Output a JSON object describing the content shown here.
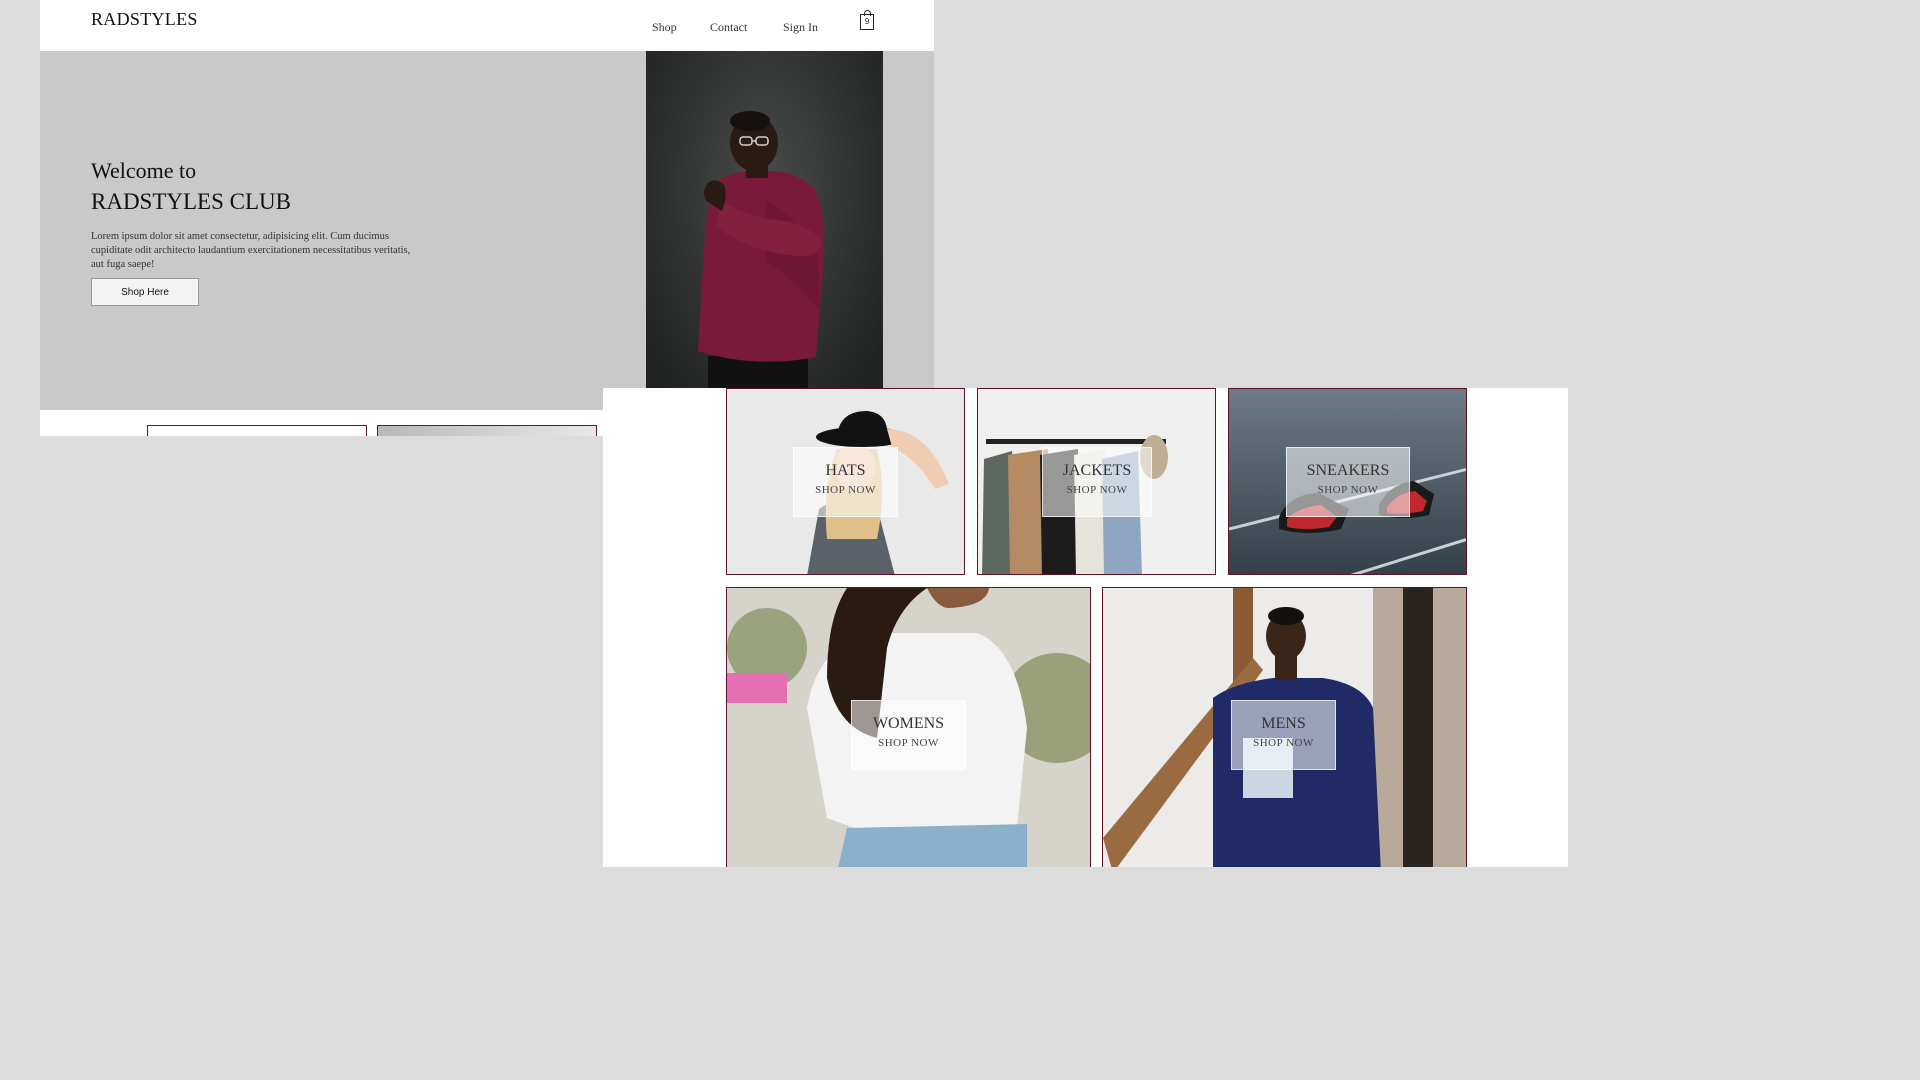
{
  "site": {
    "brand": "RADSTYLES",
    "nav": [
      "Shop",
      "Contact",
      "Sign In"
    ],
    "cart_count": "9",
    "cart_icon": "shopping-bag-icon"
  },
  "hero": {
    "welcome": "Welcome to",
    "title": "RADSTYLES CLUB",
    "description": "Lorem ipsum dolor sit amet consectetur, adipisicing elit. Cum ducimus cupiditate odit architecto laudantium exercitationem necessitatibus veritatis, aut fuga saepe!",
    "button": "Shop Here"
  },
  "categories": [
    {
      "name": "HATS",
      "cta": "SHOP NOW"
    },
    {
      "name": "JACKETS",
      "cta": "SHOP NOW"
    },
    {
      "name": "SNEAKERS",
      "cta": "SHOP NOW"
    },
    {
      "name": "WOMENS",
      "cta": "SHOP NOW"
    },
    {
      "name": "MENS",
      "cta": "SHOP NOW"
    }
  ],
  "colors": {
    "page_background": "#dcdcdc",
    "hero_background": "#c9c9c9",
    "card_border": "#5c1428",
    "sweater": "#7a1a3a"
  }
}
